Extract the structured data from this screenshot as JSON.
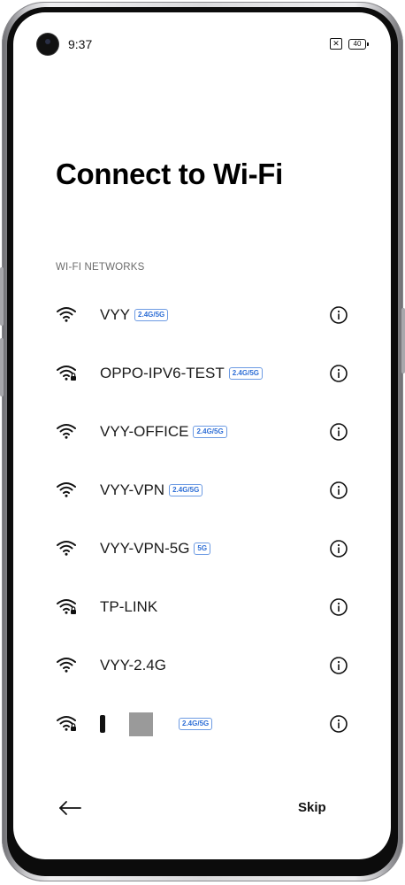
{
  "status_bar": {
    "time": "9:37",
    "sim_glyph": "✕",
    "battery": "40"
  },
  "page": {
    "title": "Connect to Wi-Fi",
    "section_label": "WI-FI NETWORKS"
  },
  "networks": [
    {
      "name": "VYY",
      "band": "2.4G/5G",
      "secured": false
    },
    {
      "name": "OPPO-IPV6-TEST",
      "band": "2.4G/5G",
      "secured": true
    },
    {
      "name": "VYY-OFFICE",
      "band": "2.4G/5G",
      "secured": false
    },
    {
      "name": "VYY-VPN",
      "band": "2.4G/5G",
      "secured": false
    },
    {
      "name": "VYY-VPN-5G",
      "band": "5G",
      "secured": false
    },
    {
      "name": "TP-LINK",
      "band": "",
      "secured": true
    },
    {
      "name": "VYY-2.4G",
      "band": "",
      "secured": false
    },
    {
      "name": "",
      "band": "2.4G/5G",
      "secured": true,
      "redacted": true
    }
  ],
  "footer": {
    "skip_label": "Skip",
    "back_icon": "arrow-left-icon"
  },
  "icons": {
    "network": "wifi-icon",
    "secured_network": "wifi-lock-icon",
    "details": "info-icon"
  },
  "colors": {
    "accent_badge": "#2f6fd6",
    "title": "#000000",
    "section_label": "#6b6b6b"
  }
}
